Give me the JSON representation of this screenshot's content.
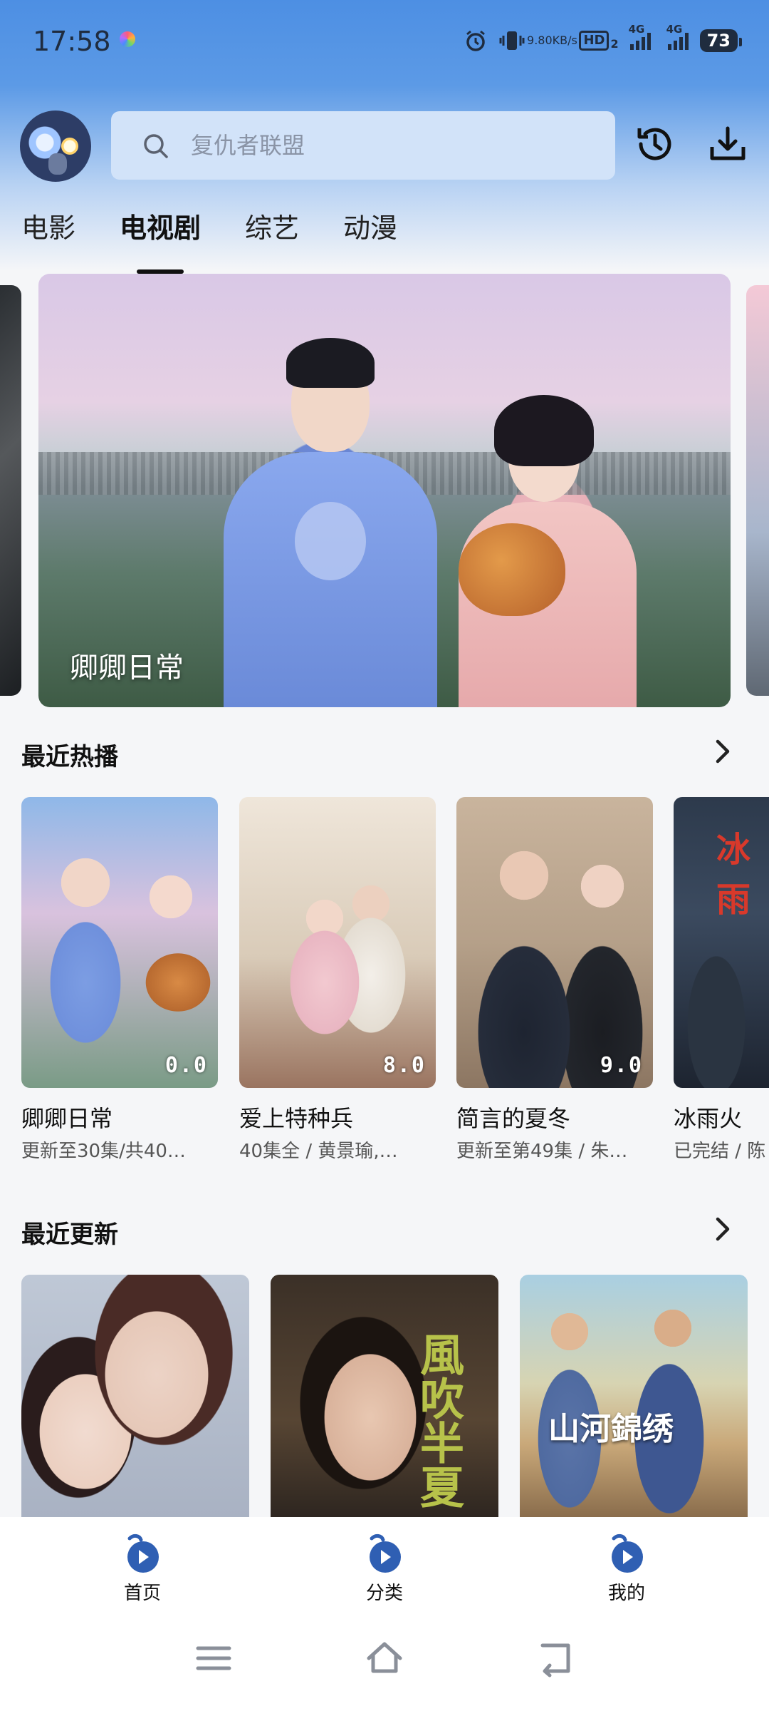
{
  "status_bar": {
    "time": "17:58",
    "net_speed_value": "9.80",
    "net_speed_unit": "KB/s",
    "hd_label": "HD",
    "hd_sub": "2",
    "signal1_label": "4G",
    "signal2_label": "4G",
    "battery": "73"
  },
  "header": {
    "search_placeholder": "复仇者联盟"
  },
  "tabs": [
    {
      "label": "电影",
      "active": false
    },
    {
      "label": "电视剧",
      "active": true
    },
    {
      "label": "综艺",
      "active": false
    },
    {
      "label": "动漫",
      "active": false
    }
  ],
  "banner": {
    "title": "卿卿日常"
  },
  "hot_section": {
    "title": "最近热播",
    "items": [
      {
        "title": "卿卿日常",
        "subtitle": "更新至30集/共40…",
        "rating": "0.0"
      },
      {
        "title": "爱上特种兵",
        "subtitle": "40集全 / 黄景瑜,…",
        "rating": "8.0"
      },
      {
        "title": "简言的夏冬",
        "subtitle": "更新至第49集 / 朱…",
        "rating": "9.0"
      },
      {
        "title": "冰雨火",
        "subtitle": "已完结 / 陈",
        "rating": ""
      }
    ],
    "poster_texts": {
      "p4": "冰雨"
    }
  },
  "update_section": {
    "title": "最近更新",
    "poster_texts": {
      "u2": "風吹半夏",
      "u3": "山河錦绣"
    }
  },
  "bottom_nav": [
    {
      "label": "首页"
    },
    {
      "label": "分类"
    },
    {
      "label": "我的"
    }
  ],
  "colors": {
    "accent": "#2f5fb3",
    "header_top": "#4d8fe3",
    "search_bg": "#d2e3f9"
  }
}
